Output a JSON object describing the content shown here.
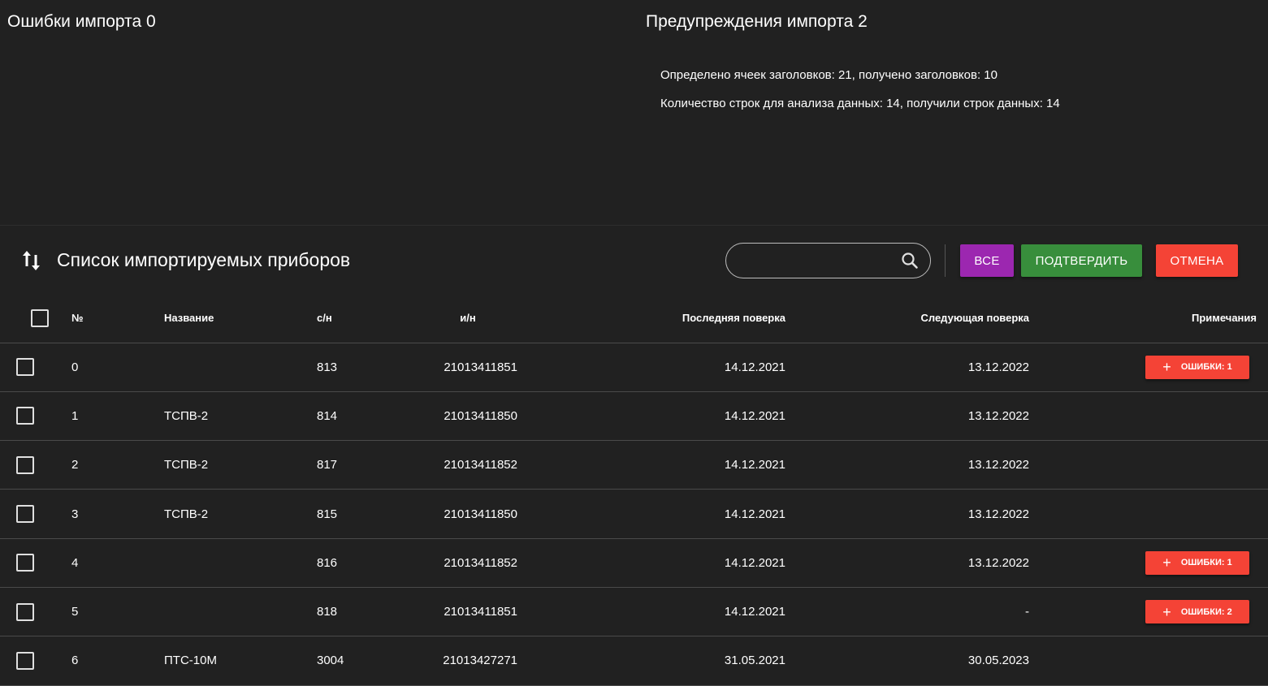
{
  "errors_panel": {
    "title": "Ошибки импорта 0"
  },
  "warnings_panel": {
    "title": "Предупреждения импорта 2",
    "items": [
      "Определено ячеек заголовков: 21, получено заголовков: 10",
      "Количество строк для анализа данных: 14, получили строк данных: 14"
    ]
  },
  "toolbar": {
    "title": "Список импортируемых приборов",
    "search_value": "",
    "buttons": {
      "all": "ВСЕ",
      "confirm": "ПОДТВЕРДИТЬ",
      "cancel": "ОТМЕНА"
    }
  },
  "table": {
    "headers": {
      "num": "№",
      "name": "Название",
      "sn": "с/н",
      "in": "и/н",
      "last": "Последняя поверка",
      "next": "Следующая поверка",
      "notes": "Примечания"
    },
    "rows": [
      {
        "num": "0",
        "name": "",
        "sn": "813",
        "in": "21013411851",
        "last": "14.12.2021",
        "next": "13.12.2022",
        "errors": "ОШИБКИ: 1"
      },
      {
        "num": "1",
        "name": "ТСПВ-2",
        "sn": "814",
        "in": "21013411850",
        "last": "14.12.2021",
        "next": "13.12.2022",
        "errors": ""
      },
      {
        "num": "2",
        "name": "ТСПВ-2",
        "sn": "817",
        "in": "21013411852",
        "last": "14.12.2021",
        "next": "13.12.2022",
        "errors": ""
      },
      {
        "num": "3",
        "name": "ТСПВ-2",
        "sn": "815",
        "in": "21013411850",
        "last": "14.12.2021",
        "next": "13.12.2022",
        "errors": ""
      },
      {
        "num": "4",
        "name": "",
        "sn": "816",
        "in": "21013411852",
        "last": "14.12.2021",
        "next": "13.12.2022",
        "errors": "ОШИБКИ: 1"
      },
      {
        "num": "5",
        "name": "",
        "sn": "818",
        "in": "21013411851",
        "last": "14.12.2021",
        "next": "-",
        "errors": "ОШИБКИ: 2"
      },
      {
        "num": "6",
        "name": "ПТС-10М",
        "sn": "3004",
        "in": "21013427271",
        "last": "31.05.2021",
        "next": "30.05.2023",
        "errors": ""
      }
    ]
  },
  "icons": {
    "sort": "sort-arrows-icon",
    "search": "search-icon",
    "add": "plus-icon"
  },
  "colors": {
    "background": "#212121",
    "all": "#9c27b0",
    "confirm": "#388e3c",
    "cancel": "#f44336"
  }
}
